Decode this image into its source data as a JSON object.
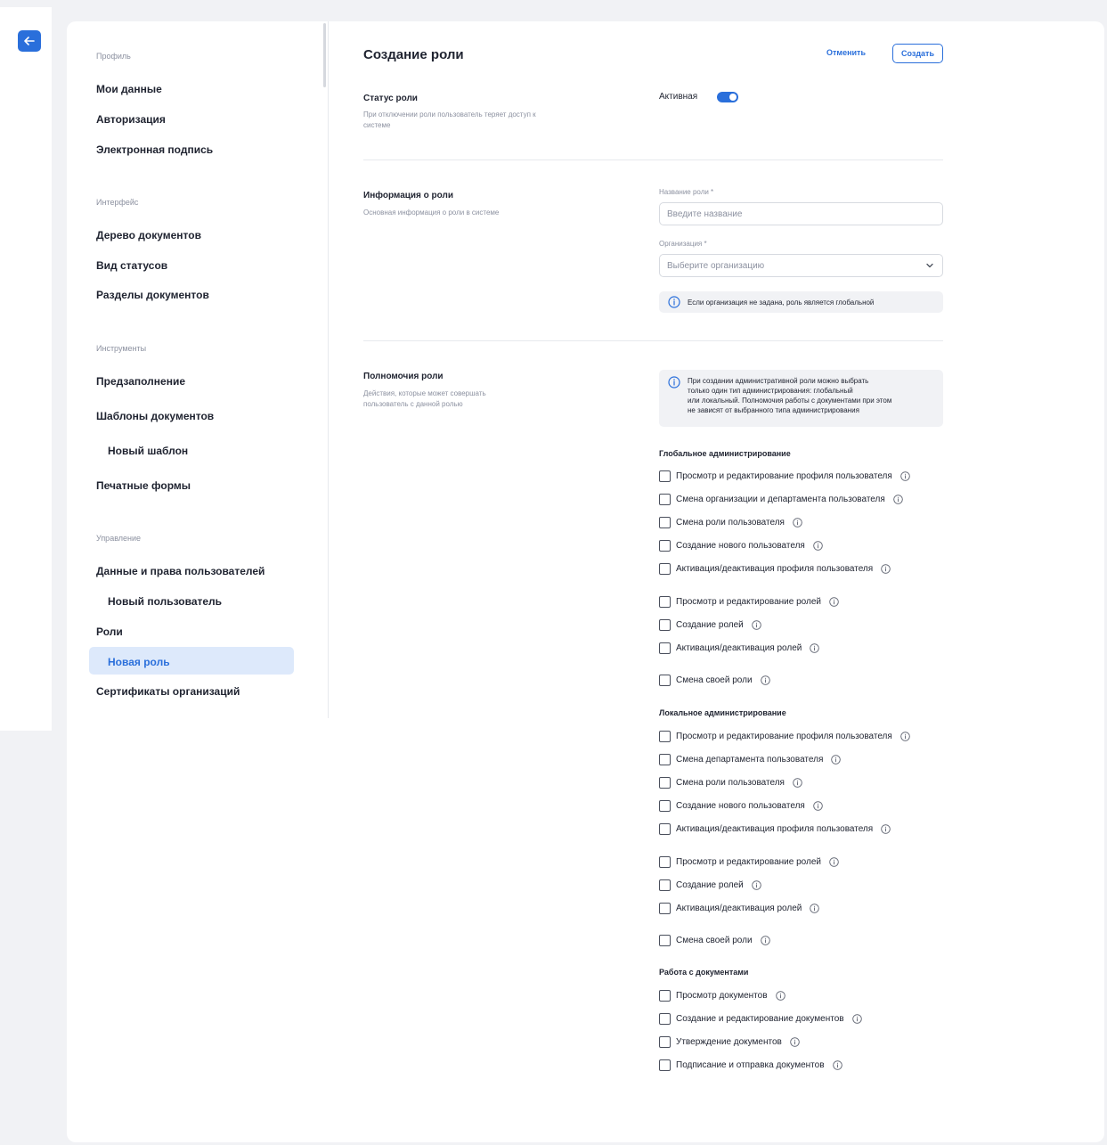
{
  "sidebar": {
    "groups": [
      {
        "title": "Профиль",
        "items": [
          "Мои данные",
          "Авторизация",
          "Электронная подпись"
        ]
      },
      {
        "title": "Интерфейс",
        "items": [
          "Дерево документов",
          "Вид статусов",
          "Разделы документов"
        ]
      },
      {
        "title": "Инструменты",
        "items": [
          "Предзаполнение",
          "Шаблоны документов",
          "Новый шаблон",
          "Печатные формы"
        ]
      },
      {
        "title": "Управление",
        "items": [
          "Данные и права пользователей",
          "Новый пользователь",
          "Роли",
          "Новая роль",
          "Сертификаты организаций"
        ]
      }
    ]
  },
  "header": {
    "title": "Создание роли",
    "cancel_label": "Отменить",
    "create_label": "Создать"
  },
  "status": {
    "title": "Статус роли",
    "description": "При отключении роли пользователь теряет доступ к системе",
    "toggle_label": "Активная",
    "active": true
  },
  "info": {
    "title": "Информация о роли",
    "description": "Основная информация о роли в системе",
    "name_label": "Название роли *",
    "name_placeholder": "Введите название",
    "org_label": "Организация *",
    "org_placeholder": "Выберите организацию",
    "org_note": "Если организация не задана, роль является глобальной"
  },
  "permissions": {
    "title": "Полномочия роли",
    "description": "Действия, которые может совершать пользователь с данной ролью",
    "note_lines": [
      "При создании административной роли можно выбрать",
      "только один тип администрирования: глобальный",
      "или локальный. Полномочия работы с документами при этом",
      "не зависят от выбранного типа администрирования"
    ],
    "global_title": "Глобальное администрирование",
    "global_items": [
      "Просмотр и редактирование профиля пользователя",
      "Смена организации и департамента пользователя",
      "Смена роли пользователя",
      "Создание нового пользователя",
      "Активация/деактивация профиля пользователя",
      "Просмотр и редактирование ролей",
      "Создание ролей",
      "Активация/деактивация ролей",
      "Смена своей роли"
    ],
    "local_title": "Локальное администрирование",
    "local_items": [
      "Просмотр и редактирование профиля пользователя",
      "Смена департамента пользователя",
      "Смена роли пользователя",
      "Создание нового пользователя",
      "Активация/деактивация профиля пользователя",
      "Просмотр и редактирование ролей",
      "Создание ролей",
      "Активация/деактивация ролей",
      "Смена своей роли"
    ],
    "docs_title": "Работа с документами",
    "docs_items": [
      "Просмотр документов",
      "Создание и редактирование документов",
      "Утверждение документов",
      "Подписание и отправка документов"
    ]
  },
  "colors": {
    "accent": "#2a6fdb",
    "active_bg": "#dde9fb",
    "muted": "#8c91a0"
  }
}
